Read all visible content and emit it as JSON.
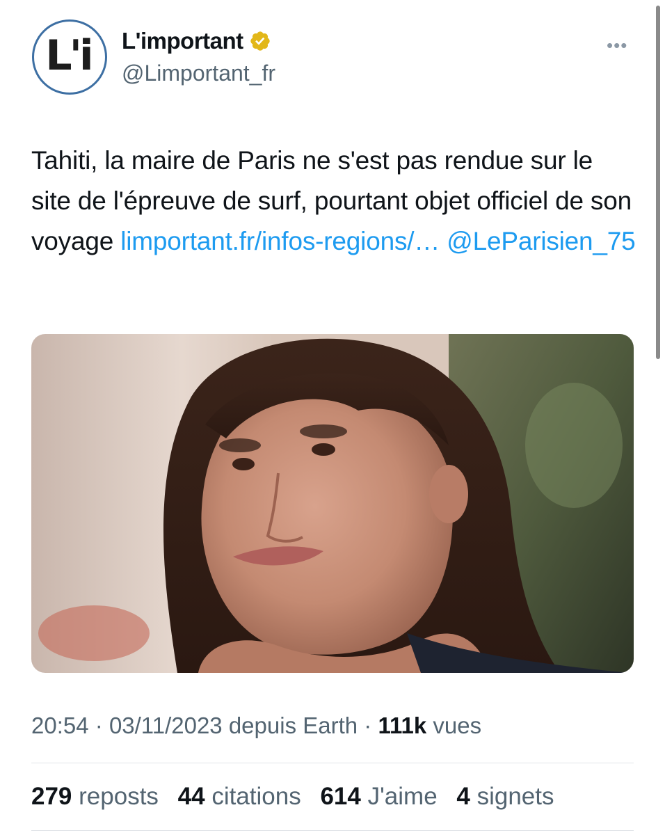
{
  "account": {
    "display_name": "L'important",
    "handle": "@Limportant_fr",
    "logo_text": "L'i",
    "verified_icon": "gold-verified-badge",
    "more_icon": "more-horizontal-icon"
  },
  "tweet": {
    "text": "Tahiti, la maire de Paris ne s'est pas rendue sur le site de l'épreuve de surf, pourtant objet officiel de son voyage ",
    "link": "limportant.fr/infos-regions/…",
    "mention": "@LeParisien_75"
  },
  "media": {
    "description_icon": "photo-image"
  },
  "meta": {
    "time": "20:54",
    "date": "03/11/2023",
    "source": "depuis Earth",
    "views": "111k",
    "views_label": "vues",
    "sep": "·"
  },
  "stats": {
    "reposts": "279",
    "reposts_label": "reposts",
    "quotes": "44",
    "quotes_label": "citations",
    "likes": "614",
    "likes_label": "J'aime",
    "bookmarks": "4",
    "bookmarks_label": "signets"
  },
  "colors": {
    "link": "#1d9bf0",
    "secondary_text": "#536471",
    "avatar_ring": "#3d6fa3",
    "verified_gold": "#e2b719"
  }
}
